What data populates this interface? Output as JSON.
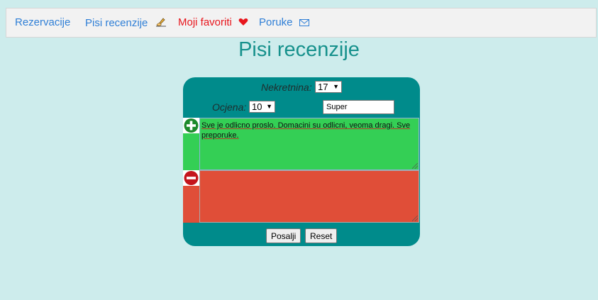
{
  "nav": {
    "items": [
      {
        "label": "Rezervacije"
      },
      {
        "label": "Pisi recenzije",
        "icon": "writing-hand-icon"
      },
      {
        "label": "Moji favoriti",
        "icon": "heart-icon",
        "color": "#e8161d"
      },
      {
        "label": "Poruke",
        "icon": "envelope-icon"
      }
    ]
  },
  "page": {
    "title": "Pisi recenzije"
  },
  "form": {
    "property_label": "Nekretnina:",
    "property_value": "17",
    "rating_label": "Ocjena:",
    "rating_value": "10",
    "review_title_value": "Super",
    "pros_text": "Sve je odlicno proslo. Domacini su odlicni, veoma dragi. Sve preporuke.",
    "cons_text": "",
    "submit_label": "Posalji",
    "reset_label": "Reset"
  },
  "colors": {
    "background": "#cdecec",
    "panel": "#008b8b",
    "pros": "#34cf55",
    "cons": "#e04e38",
    "title": "#16918c",
    "nav_link": "#2f7fd6"
  }
}
